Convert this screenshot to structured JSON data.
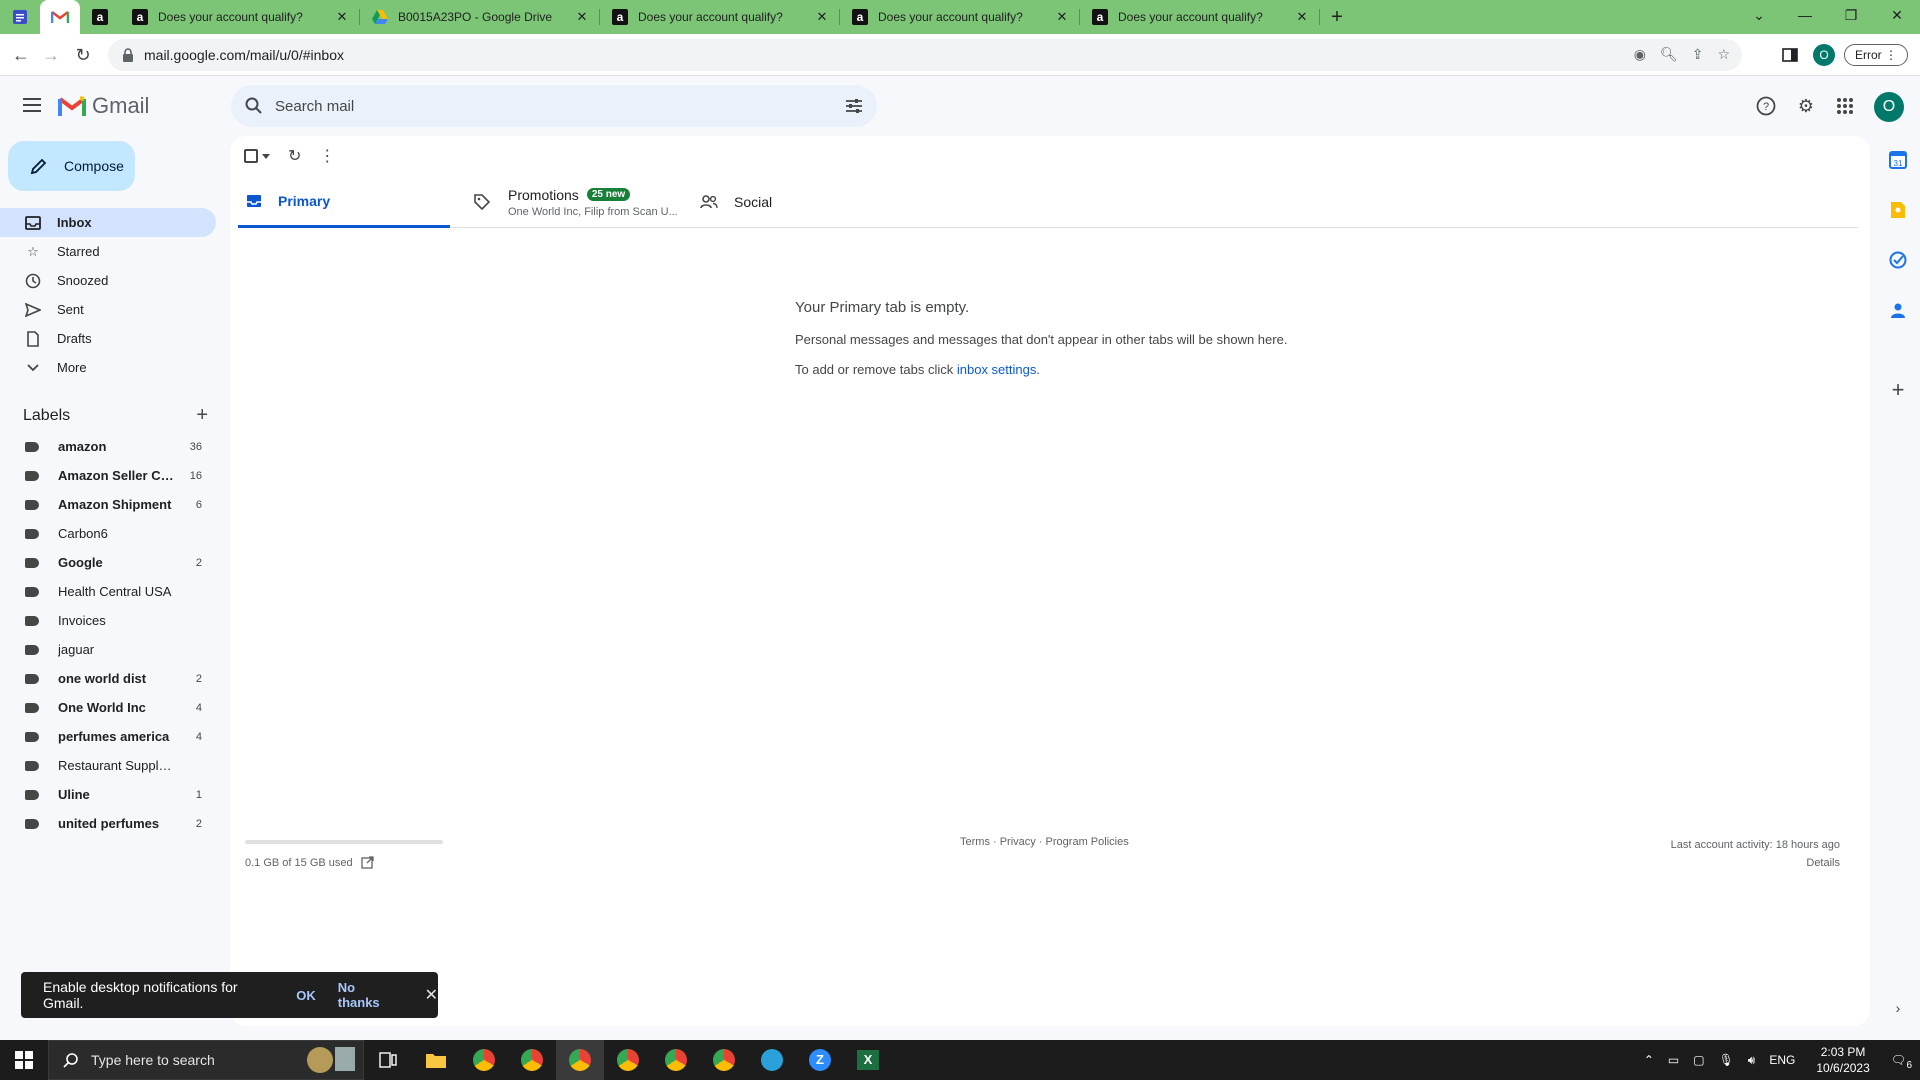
{
  "browser": {
    "tabs": [
      {
        "title": "Does your account qualify?",
        "icon": "amazon-icon"
      },
      {
        "title": "B0015A23PO - Google Drive",
        "icon": "google-drive-icon"
      },
      {
        "title": "Does your account qualify?",
        "icon": "amazon-icon"
      },
      {
        "title": "Does your account qualify?",
        "icon": "amazon-icon"
      },
      {
        "title": "Does your account qualify?",
        "icon": "amazon-icon"
      }
    ],
    "url": "mail.google.com/mail/u/0/#inbox",
    "profile_initial": "O",
    "error_label": "Error"
  },
  "header": {
    "app_name": "Gmail",
    "search_placeholder": "Search mail",
    "avatar_initial": "O"
  },
  "sidebar": {
    "compose_label": "Compose",
    "nav": [
      {
        "label": "Inbox",
        "icon": "inbox-icon"
      },
      {
        "label": "Starred",
        "icon": "star-icon"
      },
      {
        "label": "Snoozed",
        "icon": "clock-icon"
      },
      {
        "label": "Sent",
        "icon": "send-icon"
      },
      {
        "label": "Drafts",
        "icon": "draft-icon"
      },
      {
        "label": "More",
        "icon": "chevron-down-icon"
      }
    ],
    "labels_title": "Labels",
    "labels": [
      {
        "name": "amazon",
        "count": "36",
        "bold": true
      },
      {
        "name": "Amazon Seller Ce...",
        "count": "16",
        "bold": true
      },
      {
        "name": "Amazon Shipment",
        "count": "6",
        "bold": true
      },
      {
        "name": "Carbon6",
        "count": "",
        "bold": false
      },
      {
        "name": "Google",
        "count": "2",
        "bold": true
      },
      {
        "name": "Health Central USA",
        "count": "",
        "bold": false
      },
      {
        "name": "Invoices",
        "count": "",
        "bold": false
      },
      {
        "name": "jaguar",
        "count": "",
        "bold": false
      },
      {
        "name": "one world dist",
        "count": "2",
        "bold": true
      },
      {
        "name": "One World Inc",
        "count": "4",
        "bold": true
      },
      {
        "name": "perfumes america",
        "count": "4",
        "bold": true
      },
      {
        "name": "Restaurant Supply D",
        "count": "",
        "bold": false
      },
      {
        "name": "Uline",
        "count": "1",
        "bold": true
      },
      {
        "name": "united perfumes",
        "count": "2",
        "bold": true
      }
    ]
  },
  "main": {
    "tabs": {
      "primary": "Primary",
      "promotions": "Promotions",
      "promotions_badge": "25 new",
      "promotions_sub": "One World Inc, Filip from Scan U...",
      "social": "Social"
    },
    "empty": {
      "heading": "Your Primary tab is empty.",
      "line1": "Personal messages and messages that don't appear in other tabs will be shown here.",
      "line2_prefix": "To add or remove tabs click ",
      "line2_link": "inbox settings",
      "line2_suffix": "."
    },
    "footer": {
      "storage": "0.1 GB of 15 GB used",
      "links": "Terms · Privacy · Program Policies",
      "activity": "Last account activity: 18 hours ago",
      "details": "Details"
    }
  },
  "snackbar": {
    "message": "Enable desktop notifications for Gmail.",
    "ok": "OK",
    "no_thanks": "No thanks"
  },
  "taskbar": {
    "search_placeholder": "Type here to search",
    "language": "ENG",
    "time": "2:03 PM",
    "date": "10/6/2023",
    "notification_count": "6"
  }
}
